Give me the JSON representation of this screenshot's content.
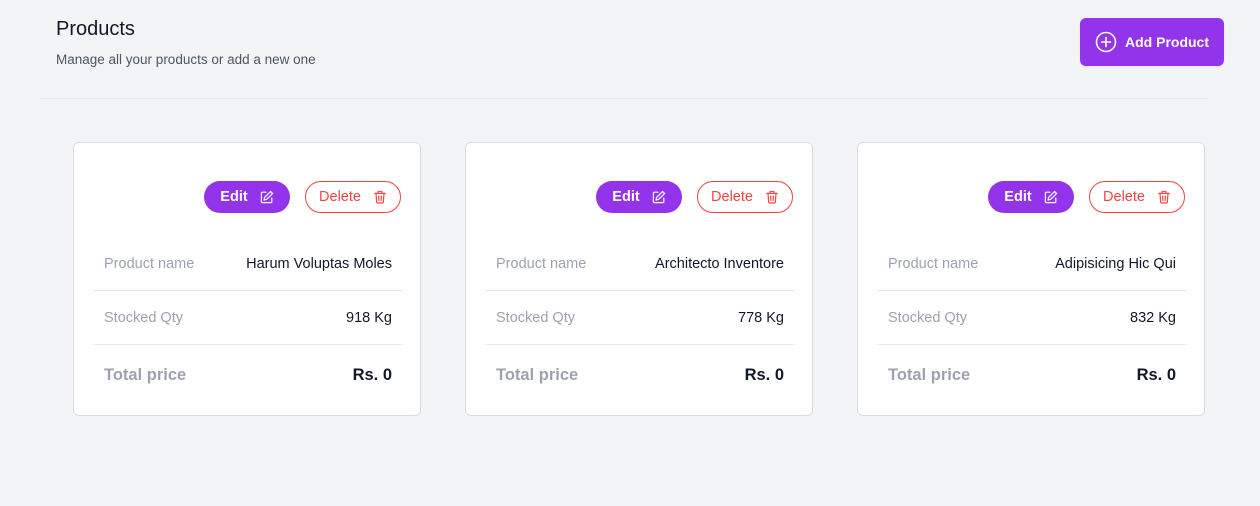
{
  "header": {
    "title": "Products",
    "subtitle": "Manage all your products or add a new one",
    "add_button_label": "Add Product"
  },
  "labels": {
    "edit": "Edit",
    "delete": "Delete",
    "product_name": "Product name",
    "stocked_qty": "Stocked Qty",
    "total_price": "Total price"
  },
  "products": [
    {
      "name": "Harum Voluptas Moles",
      "qty": "918 Kg",
      "total": "Rs. 0"
    },
    {
      "name": "Architecto Inventore",
      "qty": "778 Kg",
      "total": "Rs. 0"
    },
    {
      "name": "Adipisicing Hic Qui",
      "qty": "832 Kg",
      "total": "Rs. 0"
    }
  ],
  "colors": {
    "accent": "#9333ea",
    "danger": "#ef4444",
    "background": "#f3f4f6"
  },
  "icons": {
    "add": "plus-circle-icon",
    "edit": "pencil-square-icon",
    "delete": "trash-icon"
  }
}
